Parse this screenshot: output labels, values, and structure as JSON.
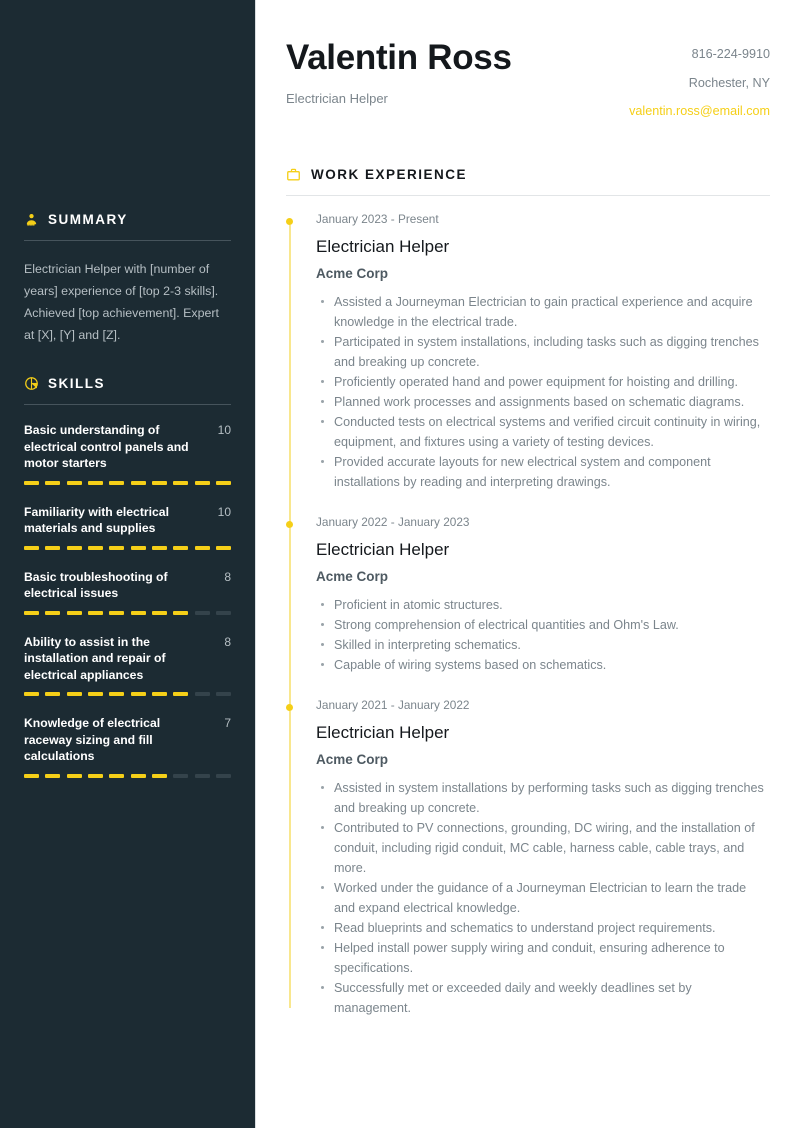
{
  "theme": {
    "accent": "#f5cf18",
    "sidebar_bg": "#1c2b33",
    "heading": "#14181c",
    "body_text": "#7b858c"
  },
  "header": {
    "name": "Valentin Ross",
    "job_title": "Electrician Helper",
    "contact": {
      "phone": "816-224-9910",
      "location": "Rochester, NY",
      "email": "valentin.ross@email.com"
    }
  },
  "sidebar": {
    "summary": {
      "icon": "person-icon",
      "title": "SUMMARY",
      "text": "Electrician Helper with [number of years] experience of [top 2-3 skills]. Achieved [top achievement]. Expert at [X], [Y] and [Z]."
    },
    "skills": {
      "icon": "pie-chart-icon",
      "title": "SKILLS",
      "max": 10,
      "items": [
        {
          "name": "Basic understanding of electrical control panels and motor starters",
          "score": 10
        },
        {
          "name": "Familiarity with electrical materials and supplies",
          "score": 10
        },
        {
          "name": "Basic troubleshooting of electrical issues",
          "score": 8
        },
        {
          "name": "Ability to assist in the installation and repair of electrical appliances",
          "score": 8
        },
        {
          "name": "Knowledge of electrical raceway sizing and fill calculations",
          "score": 7
        }
      ]
    }
  },
  "main": {
    "work_experience": {
      "icon": "briefcase-icon",
      "title": "WORK EXPERIENCE",
      "entries": [
        {
          "date": "January 2023 - Present",
          "role": "Electrician Helper",
          "company": "Acme Corp",
          "bullets": [
            "Assisted a Journeyman Electrician to gain practical experience and acquire knowledge in the electrical trade.",
            "Participated in system installations, including tasks such as digging trenches and breaking up concrete.",
            "Proficiently operated hand and power equipment for hoisting and drilling.",
            "Planned work processes and assignments based on schematic diagrams.",
            "Conducted tests on electrical systems and verified circuit continuity in wiring, equipment, and fixtures using a variety of testing devices.",
            "Provided accurate layouts for new electrical system and component installations by reading and interpreting drawings."
          ]
        },
        {
          "date": "January 2022 - January 2023",
          "role": "Electrician Helper",
          "company": "Acme Corp",
          "bullets": [
            "Proficient in atomic structures.",
            "Strong comprehension of electrical quantities and Ohm's Law.",
            "Skilled in interpreting schematics.",
            "Capable of wiring systems based on schematics."
          ]
        },
        {
          "date": "January 2021 - January 2022",
          "role": "Electrician Helper",
          "company": "Acme Corp",
          "bullets": [
            "Assisted in system installations by performing tasks such as digging trenches and breaking up concrete.",
            "Contributed to PV connections, grounding, DC wiring, and the installation of conduit, including rigid conduit, MC cable, harness cable, cable trays, and more.",
            "Worked under the guidance of a Journeyman Electrician to learn the trade and expand electrical knowledge.",
            "Read blueprints and schematics to understand project requirements.",
            "Helped install power supply wiring and conduit, ensuring adherence to specifications.",
            "Successfully met or exceeded daily and weekly deadlines set by management."
          ]
        }
      ]
    }
  }
}
